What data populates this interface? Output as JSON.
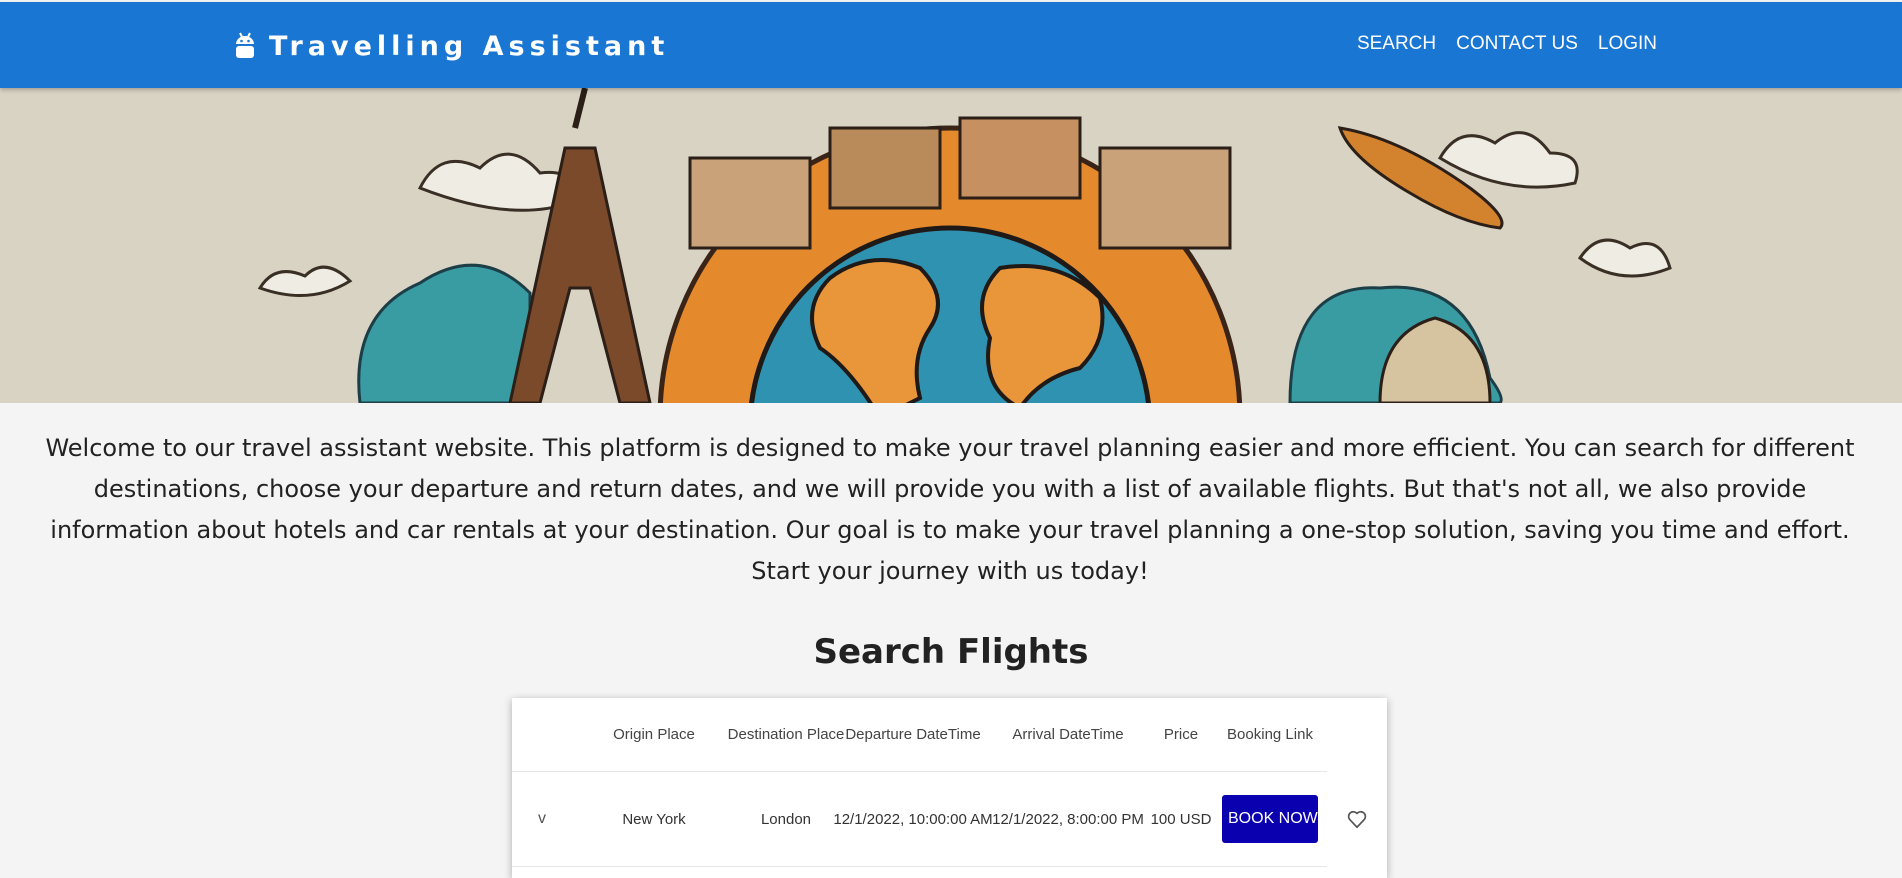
{
  "header": {
    "brand": "Travelling Assistant",
    "brand_icon": "android-icon",
    "nav": [
      {
        "label": "SEARCH"
      },
      {
        "label": "CONTACT US"
      },
      {
        "label": "LOGIN"
      }
    ],
    "bar_color": "#1976d2"
  },
  "hero": {
    "image": "illustrated-globe-landmarks-banner"
  },
  "intro": {
    "text": "Welcome to our travel assistant website. This platform is designed to make your travel planning easier and more efficient. You can search for different destinations, choose your departure and return dates, and we will provide you with a list of available flights. But that's not all, we also provide information about hotels and car rentals at your destination. Our goal is to make your travel planning a one-stop solution, saving you time and effort. Start your journey with us today!"
  },
  "search": {
    "title": "Search Flights",
    "columns": [
      "Origin Place",
      "Destination Place",
      "Departure DateTime",
      "Arrival DateTime",
      "Price",
      "Booking Link"
    ],
    "rows": [
      {
        "origin": "New York",
        "destination": "London",
        "departure": "12/1/2022, 10:00:00 AM",
        "arrival": "12/1/2022, 8:00:00 PM",
        "price": "100 USD",
        "action": "BOOK NOW"
      }
    ],
    "expand_glyph": "v",
    "button_color": "#0a00b0"
  }
}
